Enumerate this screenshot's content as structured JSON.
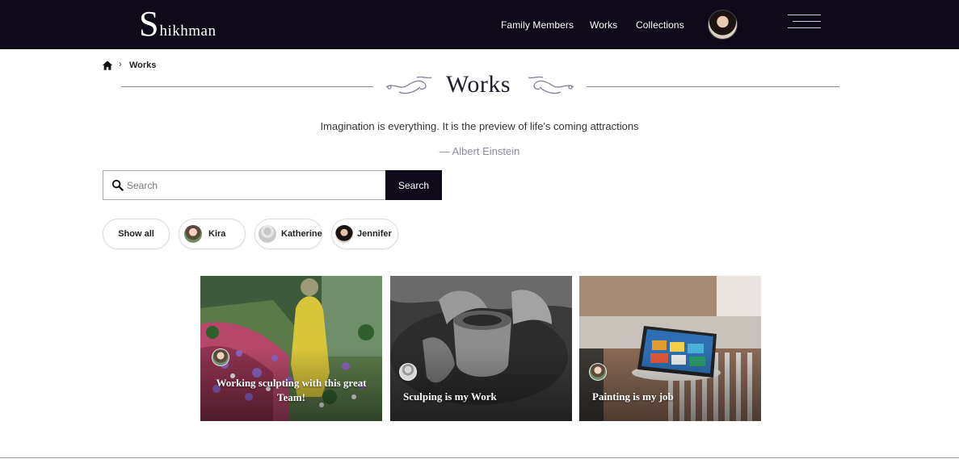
{
  "header": {
    "logo_initial": "S",
    "logo_rest": "hikhman",
    "nav": [
      "Family Members",
      "Works",
      "Collections"
    ]
  },
  "breadcrumb": {
    "current": "Works"
  },
  "page": {
    "title": "Works",
    "quote": "Imagination is everything. It is the preview of life's coming attractions",
    "author": "— Albert Einstein"
  },
  "search": {
    "placeholder": "Search",
    "button": "Search"
  },
  "filters": [
    "Show all",
    "Kira",
    "Katherine",
    "Jennifer"
  ],
  "cards": [
    {
      "title": "Working sculpting with this great Team!"
    },
    {
      "title": "Sculping is my Work"
    },
    {
      "title": "Painting is my job"
    }
  ],
  "colors": {
    "header_bg": "#0e0a1a",
    "accent_text": "#8b8ba4"
  },
  "icons": [
    "home-icon",
    "chevron-right-icon",
    "search-icon",
    "hamburger-menu-icon",
    "flourish-ornament"
  ]
}
